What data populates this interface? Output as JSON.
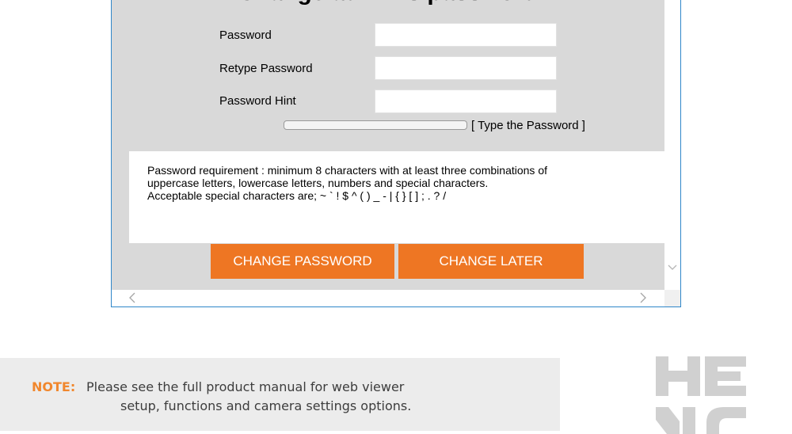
{
  "dialog": {
    "title": "Change admin's password",
    "fields": [
      {
        "label": "Password",
        "value": ""
      },
      {
        "label": "Retype Password",
        "value": ""
      },
      {
        "label": "Password Hint",
        "value": ""
      }
    ],
    "strength": {
      "text": "[ Type the Password ]",
      "level": 0
    },
    "requirement": {
      "line1": "Password requirement : minimum 8 characters with at least three combinations of",
      "line2": "uppercase letters, lowercase letters, numbers and special characters.",
      "line3": "Acceptable special characters are; ~ ` ! $ ^ ( ) _ - | { } [ ] ; . ? /"
    },
    "buttons": {
      "change": "CHANGE PASSWORD",
      "later": "CHANGE LATER"
    }
  },
  "colors": {
    "accent": "#ee7623",
    "frame_border": "#2f86c9",
    "content_bg": "#d9d9d9",
    "note_label": "#f1872d"
  },
  "icons": {
    "vscroll_down": "chevron-down-icon",
    "hscroll_left": "chevron-left-icon",
    "hscroll_right": "chevron-right-icon"
  },
  "note": {
    "label": "NOTE:",
    "line1": "Please see the full product manual for web viewer",
    "line2": "setup, functions and camera settings options."
  }
}
